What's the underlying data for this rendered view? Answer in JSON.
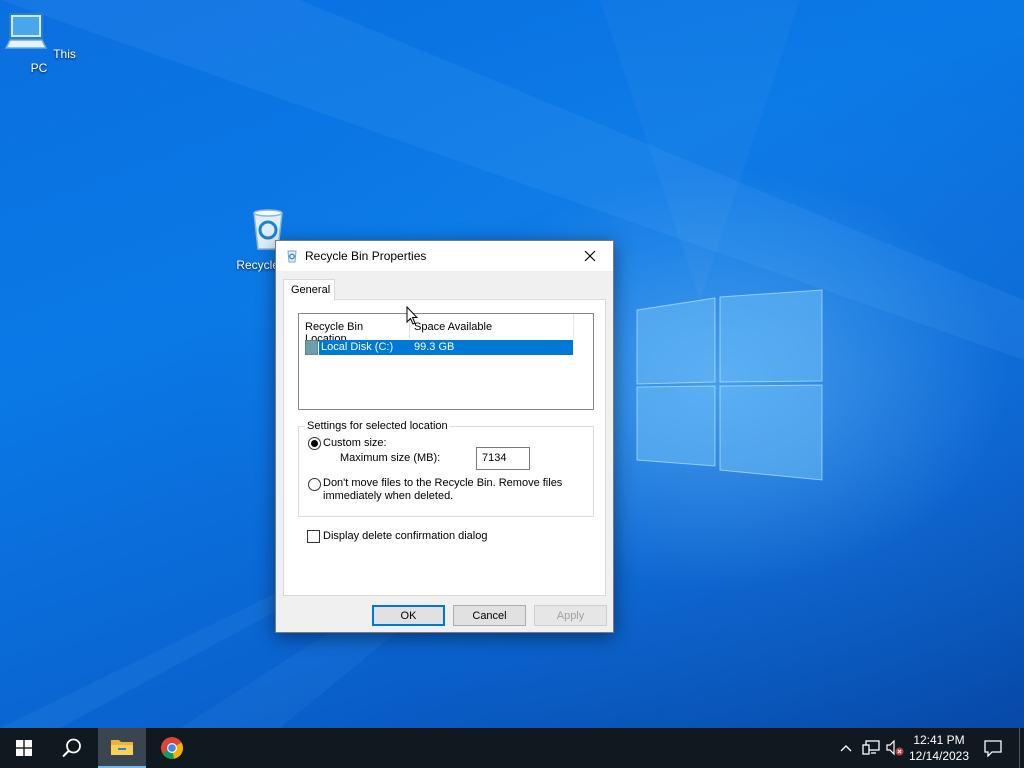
{
  "desktop": {
    "icons": [
      {
        "label": "This PC",
        "icon": "computer-icon"
      },
      {
        "label": "Recycle Bin",
        "icon": "recycle-bin-icon"
      }
    ]
  },
  "dialog": {
    "title": "Recycle Bin Properties",
    "tabs": [
      {
        "label": "General",
        "active": true
      }
    ],
    "list": {
      "columns": [
        "Recycle Bin Location",
        "Space Available"
      ],
      "rows": [
        {
          "location": "Local Disk (C:)",
          "space": "99.3 GB",
          "selected": true
        }
      ]
    },
    "settings": {
      "legend": "Settings for selected location",
      "custom_size_label": "Custom size:",
      "custom_size_selected": true,
      "max_size_label": "Maximum size (MB):",
      "max_size_value": "7134",
      "dont_move_label": "Don't move files to the Recycle Bin. Remove files immediately when deleted.",
      "dont_move_selected": false
    },
    "confirm_label": "Display delete confirmation dialog",
    "confirm_checked": false,
    "buttons": {
      "ok": "OK",
      "cancel": "Cancel",
      "apply": "Apply"
    }
  },
  "taskbar": {
    "pinned": [
      "start-icon",
      "search-icon",
      "file-explorer-icon",
      "chrome-icon"
    ],
    "clock": {
      "time": "12:41 PM",
      "date": "12/14/2023"
    },
    "tray_icons": [
      "chevron-up-icon",
      "network-icon",
      "volume-muted-icon",
      "notification-icon"
    ]
  },
  "colors": {
    "accent": "#0078d7",
    "taskbar": "#101820",
    "desktop": "#0a6ad8"
  }
}
